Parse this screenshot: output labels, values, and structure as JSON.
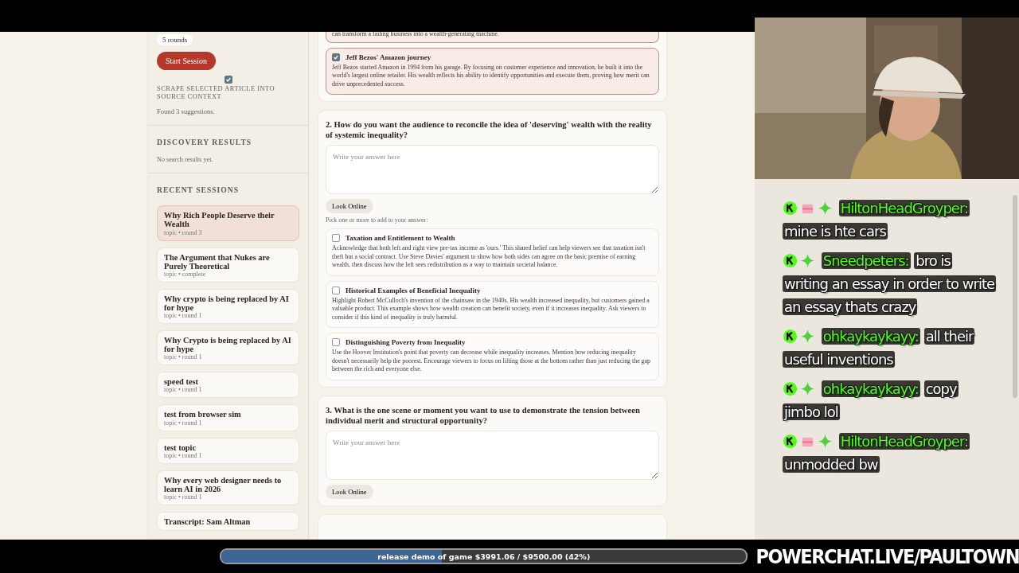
{
  "sidebar": {
    "rounds_chip": "5 rounds",
    "start_button": "Start Session",
    "scrape": {
      "checked": true,
      "label": "SCRAPE SELECTED ARTICLE INTO SOURCE CONTEXT"
    },
    "status": "Found 3 suggestions.",
    "discovery": {
      "heading": "DISCOVERY RESULTS",
      "empty": "No search results yet."
    },
    "recent": {
      "heading": "RECENT SESSIONS",
      "sessions": [
        {
          "title": "Why Rich People Deserve their Wealth",
          "meta": "topic • round 3",
          "selected": true
        },
        {
          "title": "The Argument that Nukes are Purely Theoretical",
          "meta": "topic • complete",
          "selected": false
        },
        {
          "title": "Why crypto is being replaced by AI for hype",
          "meta": "topic • round 1",
          "selected": false
        },
        {
          "title": "Why Crypto is being replaced by AI for hype",
          "meta": "topic • round 1",
          "selected": false
        },
        {
          "title": "speed test",
          "meta": "topic • round 1",
          "selected": false
        },
        {
          "title": "test from browser sim",
          "meta": "topic • round 1",
          "selected": false
        },
        {
          "title": "test topic",
          "meta": "topic • round 1",
          "selected": false
        },
        {
          "title": "Why every web designer needs to learn AI in 2026",
          "meta": "topic • round 1",
          "selected": false
        },
        {
          "title": "Transcript: Sam Altman",
          "selected": false
        }
      ]
    }
  },
  "previous_card": {
    "cut_text": "can transform a failing business into a wealth-generating machine.",
    "option": {
      "title": "Jeff Bezos' Amazon journey",
      "body": "Jeff Bezos started Amazon in 1994 from his garage. By focusing on customer experience and innovation, he built it into the world's largest online retailer. His wealth reflects his ability to identify opportunities and execute them, proving how merit can drive unprecedented success.",
      "checked": true
    }
  },
  "questions": [
    {
      "title": "2. How do you want the audience to reconcile the idea of 'deserving' wealth with the reality of systemic inequality?",
      "placeholder": "Write your answer here",
      "look_button": "Look Online",
      "hint": "Pick one or more to add to your answer:",
      "options": [
        {
          "title": "Taxation and Entitlement to Wealth",
          "body": "Acknowledge that both left and right view pre-tax income as 'ours.' This shared belief can help viewers see that taxation isn't theft but a social contract. Use Steve Davies' argument to show how both sides can agree on the basic premise of earning wealth, then discuss how the left sees redistribution as a way to maintain societal balance.",
          "checked": false
        },
        {
          "title": "Historical Examples of Beneficial Inequality",
          "body": "Highlight Robert McCulloch's invention of the chainsaw in the 1940s. His wealth increased inequality, but customers gained a valuable product. This example shows how wealth creation can benefit society, even if it increases inequality. Ask viewers to consider if this kind of inequality is truly harmful.",
          "checked": false
        },
        {
          "title": "Distinguishing Poverty from Inequality",
          "body": "Use the Hoover Institution's point that poverty can decrease while inequality increases. Mention how reducing inequality doesn't necessarily help the poorest. Encourage viewers to focus on lifting those at the bottom rather than just reducing the gap between the rich and everyone else.",
          "checked": false
        }
      ]
    },
    {
      "title": "3. What is the one scene or moment you want to use to demonstrate the tension between individual merit and structural opportunity?",
      "placeholder": "Write your answer here",
      "look_button": "Look Online"
    }
  ],
  "chat": {
    "messages": [
      {
        "badges": [
          {
            "kind": "kick"
          },
          {
            "kind": "gift"
          },
          {
            "kind": "diamond"
          }
        ],
        "user": "HiltonHeadGroyper:",
        "text": "mine is hte cars"
      },
      {
        "badges": [
          {
            "kind": "kick"
          },
          {
            "kind": "diamond"
          }
        ],
        "user": "Sneedpeters:",
        "text": "bro is writing an essay in order to write an essay thats crazy"
      },
      {
        "badges": [
          {
            "kind": "kick"
          },
          {
            "kind": "diamond"
          }
        ],
        "user": "ohkaykaykayy:",
        "text": "all their useful inventions"
      },
      {
        "badges": [
          {
            "kind": "kick"
          },
          {
            "kind": "diamond"
          }
        ],
        "user": "ohkaykaykayy:",
        "text": "copy jimbo lol"
      },
      {
        "badges": [
          {
            "kind": "kick"
          },
          {
            "kind": "gift"
          },
          {
            "kind": "diamond"
          }
        ],
        "user": "HiltonHeadGroyper:",
        "text": "unmodded bw"
      }
    ]
  },
  "goal": {
    "label": "release demo of game $3991.06 / $9500.00 (42%)",
    "level": 0.42
  },
  "banner": "POWERCHAT.LIVE/PAULTOWN"
}
